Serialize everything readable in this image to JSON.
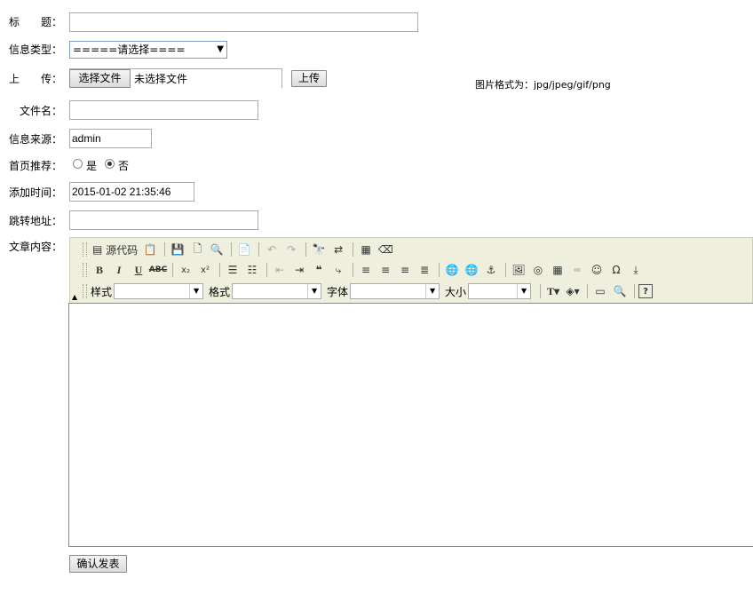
{
  "form": {
    "title_label": "标　　题：",
    "type_label": "信息类型：",
    "type_selected": "=====请选择====",
    "upload_label": "上　　传：",
    "choose_file_label": "选择文件",
    "no_file_text": "未选择文件",
    "upload_button": "上传",
    "format_hint": "图片格式为：jpg/jpeg/gif/png",
    "filename_label": "文件名：",
    "source_label": "信息来源：",
    "source_value": "admin",
    "recommend_label": "首页推荐：",
    "recommend_yes": "是",
    "recommend_no": "否",
    "recommend_selected": "否",
    "time_label": "添加时间：",
    "time_value": "2015-01-02 21:35:46",
    "redirect_label": "跳转地址：",
    "content_label": "文章内容：",
    "submit_label": "确认发表"
  },
  "editor": {
    "source_label": "源代码",
    "style_label": "样式",
    "format_label": "格式",
    "font_label": "字体",
    "size_label": "大小"
  }
}
